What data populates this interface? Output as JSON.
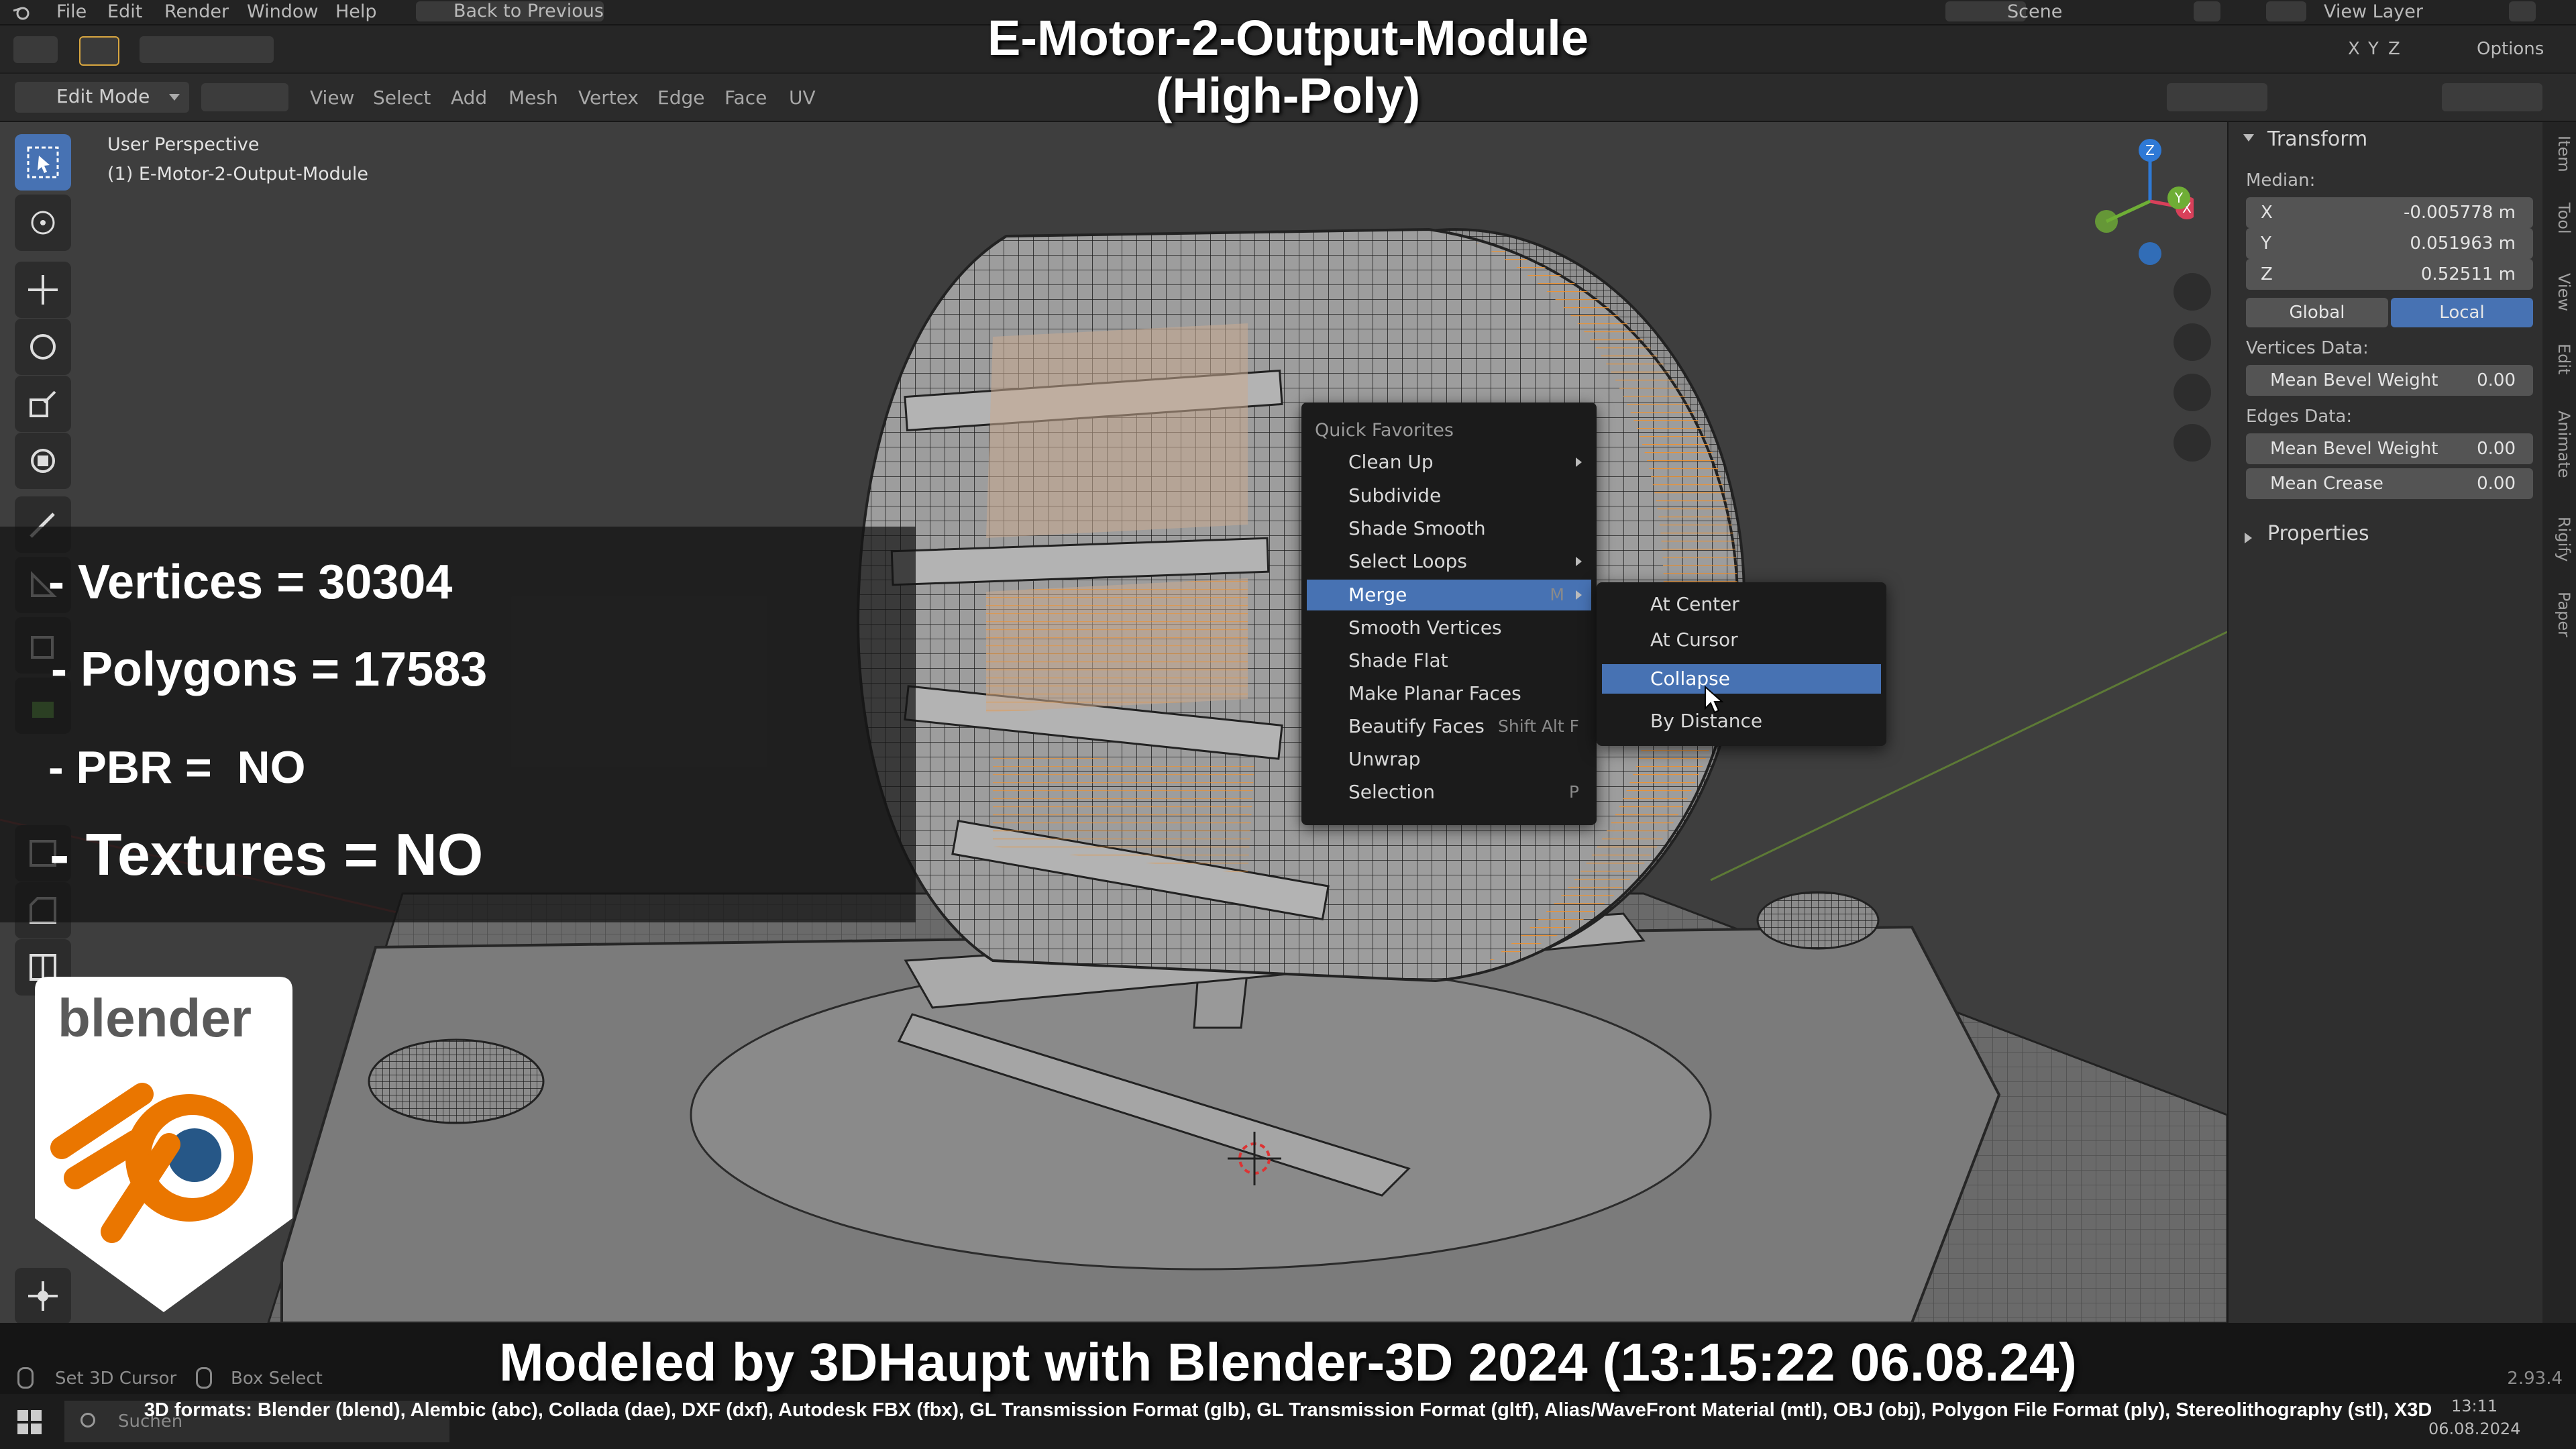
{
  "menubar": {
    "items": [
      "File",
      "Edit",
      "Render",
      "Window",
      "Help"
    ],
    "back_button": "Back to Previous",
    "scene_label": "Scene",
    "view_layer_label": "View Layer"
  },
  "header": {
    "mode": "Edit Mode",
    "menus": [
      "View",
      "Select",
      "Add",
      "Mesh",
      "Vertex",
      "Edge",
      "Face",
      "UV"
    ],
    "axes": [
      "X",
      "Y",
      "Z"
    ],
    "options_label": "Options"
  },
  "viewport": {
    "perspective_label": "User Perspective",
    "object_label": "(1) E-Motor-2-Output-Module",
    "cursor_hint": "Set 3D Cursor",
    "box_select_hint": "Box Select"
  },
  "overlay": {
    "title_line1": "E-Motor-2-Output-Module",
    "title_line2": "(High-Poly)",
    "stats": {
      "vertices": "- Vertices = 30304",
      "polygons": "- Polygons = 17583",
      "pbr": "- PBR =  NO",
      "textures": "- Textures = NO"
    },
    "credit": "Modeled by 3DHaupt with Blender-3D 2024 (13:15:22  06.08.24)",
    "formats": "3D formats: Blender (blend), Alembic (abc), Collada (dae), DXF (dxf), Autodesk FBX (fbx), GL Transmission Format (glb), GL Transmission Format (gltf), Alias/WaveFront Material (mtl), OBJ (obj), Polygon File Format (ply), Stereolithography (stl), X3D",
    "logo_text": "blender"
  },
  "quick_favorites": {
    "title": "Quick Favorites",
    "items": [
      {
        "label": "Clean Up",
        "shortcut": "",
        "submenu": true
      },
      {
        "label": "Subdivide",
        "shortcut": "",
        "submenu": false
      },
      {
        "label": "Shade Smooth",
        "shortcut": "",
        "submenu": false
      },
      {
        "label": "Select Loops",
        "shortcut": "",
        "submenu": true
      },
      {
        "label": "Merge",
        "shortcut": "M",
        "submenu": true
      },
      {
        "label": "Smooth Vertices",
        "shortcut": "",
        "submenu": false
      },
      {
        "label": "Shade Flat",
        "shortcut": "",
        "submenu": false
      },
      {
        "label": "Make Planar Faces",
        "shortcut": "",
        "submenu": false
      },
      {
        "label": "Beautify Faces",
        "shortcut": "Shift Alt F",
        "submenu": false
      },
      {
        "label": "Unwrap",
        "shortcut": "",
        "submenu": false
      },
      {
        "label": "Selection",
        "shortcut": "P",
        "submenu": false
      }
    ]
  },
  "merge_submenu": {
    "items": [
      "At Center",
      "At Cursor",
      "Collapse",
      "By Distance"
    ]
  },
  "npanel": {
    "transform_title": "Transform",
    "median_label": "Median:",
    "x": {
      "label": "X",
      "value": "-0.005778 m"
    },
    "y": {
      "label": "Y",
      "value": "0.051963 m"
    },
    "z": {
      "label": "Z",
      "value": "0.52511 m"
    },
    "global_label": "Global",
    "local_label": "Local",
    "vertices_data_label": "Vertices Data:",
    "vertex_bevel": {
      "label": "Mean Bevel Weight",
      "value": "0.00"
    },
    "edges_data_label": "Edges Data:",
    "edge_bevel": {
      "label": "Mean Bevel Weight",
      "value": "0.00"
    },
    "edge_crease": {
      "label": "Mean Crease",
      "value": "0.00"
    },
    "properties_title": "Properties",
    "tabs": [
      "Item",
      "Tool",
      "View",
      "Edit",
      "Animate",
      "Rigify",
      "Paper"
    ]
  },
  "statusbar": {
    "version": "2.93.4",
    "search_placeholder": "Suchen",
    "time": "13:11",
    "date": "06.08.2024"
  },
  "colors": {
    "accent": "#4772b3",
    "selection": "#f0922e",
    "logo_orange": "#ea7600",
    "logo_blue": "#265787"
  }
}
